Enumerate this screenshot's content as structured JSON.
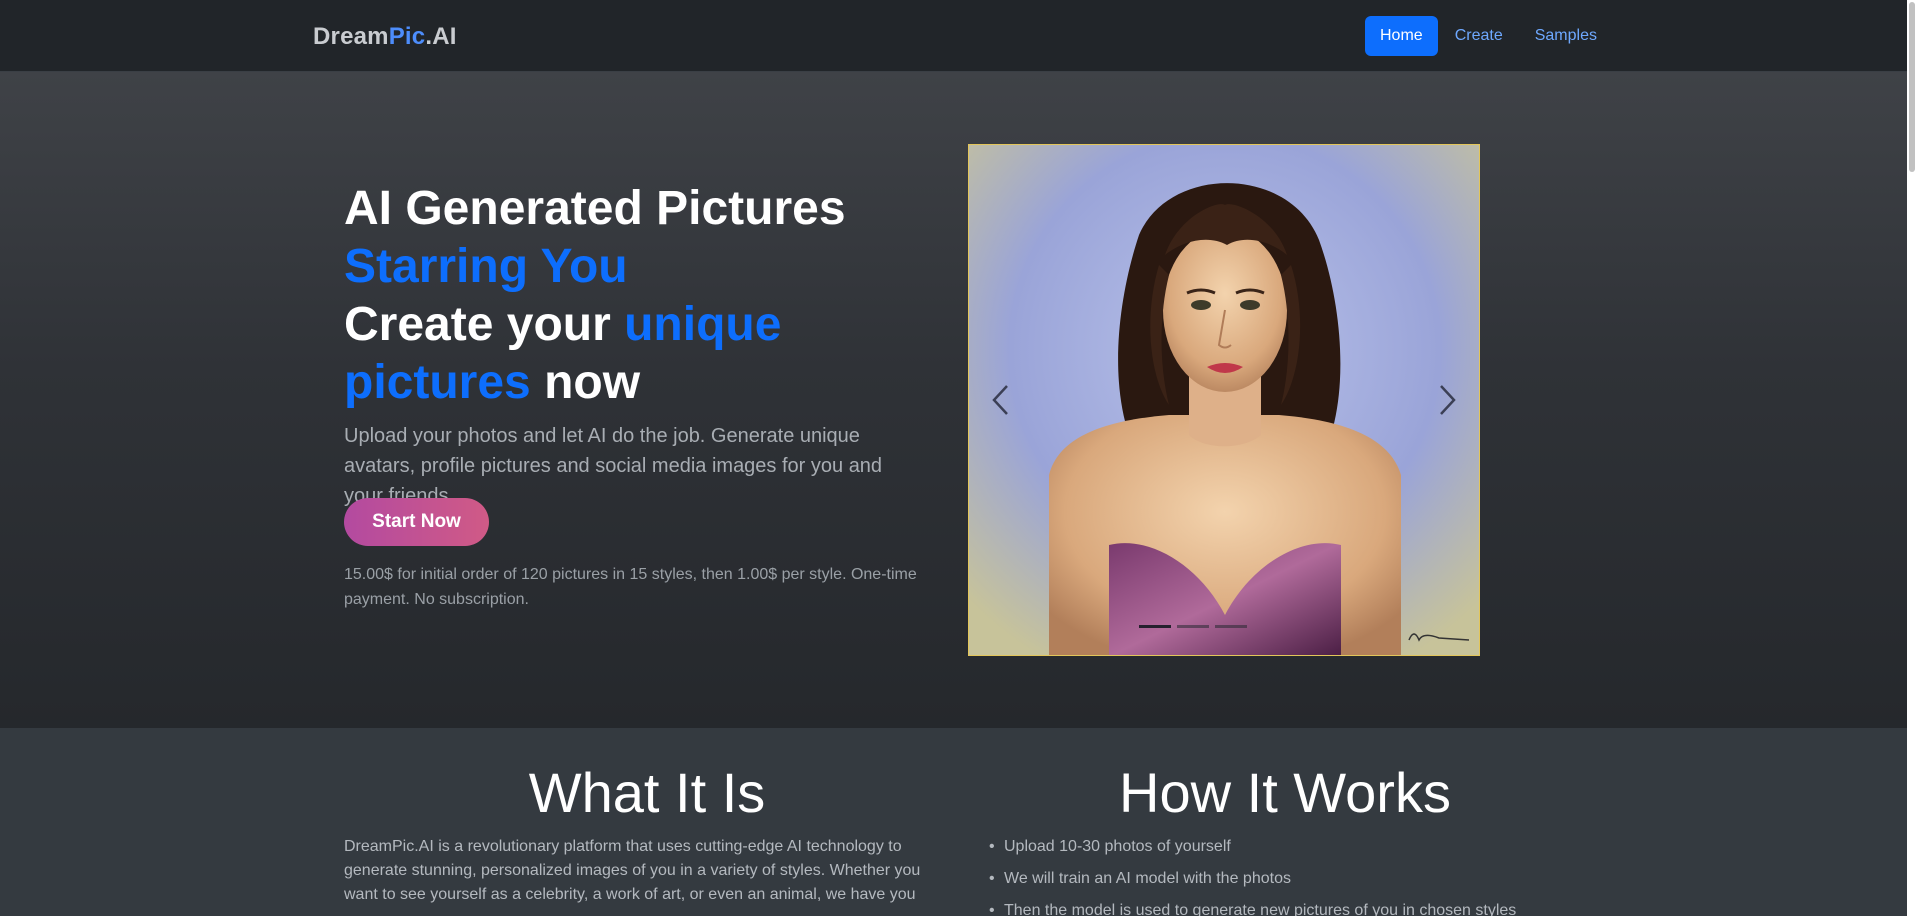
{
  "navbar": {
    "brand_part1": "Dream",
    "brand_part2": "Pic",
    "brand_part3": ".AI",
    "links": [
      {
        "label": "Home",
        "active": true
      },
      {
        "label": "Create",
        "active": false
      },
      {
        "label": "Samples",
        "active": false
      }
    ]
  },
  "hero": {
    "headline_line1": "AI Generated Pictures",
    "headline_line2": "Starring You",
    "headline_create": "Create your ",
    "headline_unique": "unique",
    "headline_pictures": "pictures",
    "headline_now": " now",
    "lead": "Upload your photos and let AI do the job. Generate unique avatars, profile pictures and social media images for you and your friends.",
    "cta_label": "Start Now",
    "price_note": "15.00$ for initial order of 120 pictures in 15 styles, then 1.00$ per style. One-time payment. No subscription."
  },
  "carousel": {
    "slide_count": 3,
    "active_index": 0,
    "prev_icon": "chevron-left-icon",
    "next_icon": "chevron-right-icon"
  },
  "what_it_is": {
    "title": "What It Is",
    "text": "DreamPic.AI is a revolutionary platform that uses cutting-edge AI technology to generate stunning, personalized images of you in a variety of styles. Whether you want to see yourself as a celebrity, a work of art, or even an animal, we have you"
  },
  "how_it_works": {
    "title": "How It Works",
    "steps": [
      "Upload 10-30 photos of yourself",
      "We will train an AI model with the photos",
      "Then the model is used to generate new pictures of you in chosen styles"
    ]
  },
  "colors": {
    "accent": "#0d6efd",
    "cta_gradient_start": "#b34aa0",
    "cta_gradient_end": "#d05a86",
    "navbar_bg": "#212529"
  }
}
